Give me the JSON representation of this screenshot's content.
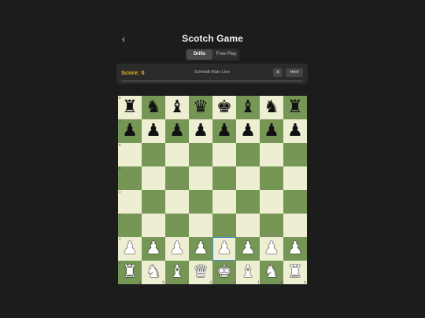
{
  "header": {
    "back_icon": "chevron-left-icon",
    "back_glyph": "‹",
    "title": "Scotch Game"
  },
  "tabs": [
    {
      "label": "Drills",
      "active": true
    },
    {
      "label": "Free Play",
      "active": false
    }
  ],
  "drill": {
    "score_label": "Score: 0",
    "line_name": "Schmidt Main Line",
    "close_glyph": "✕",
    "hint_label": "Hint!",
    "progress": 0
  },
  "board": {
    "colors": {
      "light": "#eeeed2",
      "dark": "#769656",
      "selected": "#4d8fd6"
    },
    "selected_square": "e2",
    "rank_labels": [
      "8",
      "7",
      "6",
      "5",
      "4",
      "3",
      "2",
      "1"
    ],
    "file_labels": [
      "a",
      "b",
      "c",
      "d",
      "e",
      "f",
      "g",
      "h"
    ],
    "position": [
      [
        "bR",
        "bN",
        "bB",
        "bQ",
        "bK",
        "bB",
        "bN",
        "bR"
      ],
      [
        "bP",
        "bP",
        "bP",
        "bP",
        "bP",
        "bP",
        "bP",
        "bP"
      ],
      [
        "",
        "",
        "",
        "",
        "",
        "",
        "",
        ""
      ],
      [
        "",
        "",
        "",
        "",
        "",
        "",
        "",
        ""
      ],
      [
        "",
        "",
        "",
        "",
        "",
        "",
        "",
        ""
      ],
      [
        "",
        "",
        "",
        "",
        "",
        "",
        "",
        ""
      ],
      [
        "wP",
        "wP",
        "wP",
        "wP",
        "wP",
        "wP",
        "wP",
        "wP"
      ],
      [
        "wR",
        "wN",
        "wB",
        "wQ",
        "wK",
        "wB",
        "wN",
        "wR"
      ]
    ]
  }
}
